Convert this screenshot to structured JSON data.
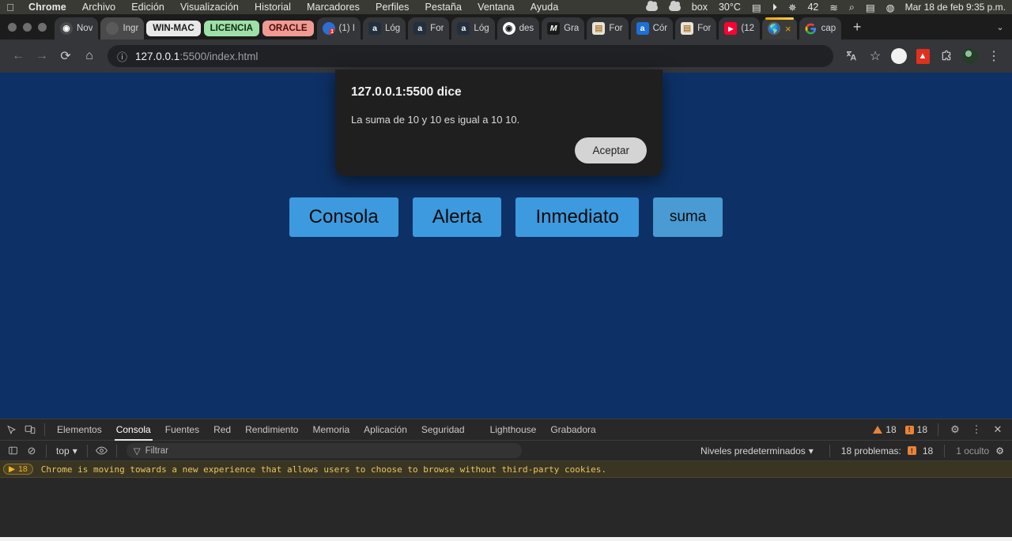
{
  "macbar": {
    "apple_icon": "apple-icon",
    "menus": [
      {
        "label": "Chrome",
        "bold": true
      },
      {
        "label": "Archivo",
        "bold": false
      },
      {
        "label": "Edición",
        "bold": false
      },
      {
        "label": "Visualización",
        "bold": false
      },
      {
        "label": "Historial",
        "bold": false
      },
      {
        "label": "Marcadores",
        "bold": false
      },
      {
        "label": "Perfiles",
        "bold": false
      },
      {
        "label": "Pestaña",
        "bold": false
      },
      {
        "label": "Ventana",
        "bold": false
      },
      {
        "label": "Ayuda",
        "bold": false
      }
    ],
    "status_items": [
      {
        "name": "cloud-icon-1",
        "text": ""
      },
      {
        "name": "cloud-icon-2",
        "text": ""
      },
      {
        "name": "box-logo",
        "text": "box"
      },
      {
        "name": "calendar-icon",
        "text": "30°C"
      },
      {
        "name": "numbers-icon",
        "text": ""
      },
      {
        "name": "play-icon",
        "text": "▶"
      },
      {
        "name": "bluetooth-icon",
        "text": "✦"
      },
      {
        "name": "battery-icon",
        "text": "42"
      },
      {
        "name": "wifi-icon",
        "text": "≋"
      },
      {
        "name": "spotlight-search-icon",
        "text": "⌕"
      },
      {
        "name": "control-center-icon",
        "text": "▤"
      },
      {
        "name": "siri-icon",
        "text": ""
      }
    ],
    "clock": "Mar 18 de feb 9:35 p.m."
  },
  "tabstrip": {
    "window_controls": [
      "close",
      "minimize",
      "maximize"
    ],
    "tabs": [
      {
        "kind": "tab",
        "favicon": "chrome-ic",
        "glyph": "◉",
        "label": "Nov",
        "group": false
      },
      {
        "kind": "tab",
        "favicon": "pill",
        "glyph": "",
        "label": "Ingr",
        "group": true
      },
      {
        "kind": "group",
        "label": "WIN-MAC",
        "bg": "#e8e8e8",
        "fg": "#1a1a1a"
      },
      {
        "kind": "group",
        "label": "LICENCIA",
        "bg": "#9ee0a8",
        "fg": "#0f2a14"
      },
      {
        "kind": "group",
        "label": "ORACLE",
        "bg": "#f09a95",
        "fg": "#4a0d0a"
      },
      {
        "kind": "tab",
        "favicon": "chrome-notif",
        "glyph": "1",
        "label": "(1) I",
        "group": false
      },
      {
        "kind": "tab",
        "favicon": "amazon",
        "glyph": "a",
        "label": "Lóg",
        "group": false
      },
      {
        "kind": "tab",
        "favicon": "amazon",
        "glyph": "a",
        "label": "For",
        "group": false
      },
      {
        "kind": "tab",
        "favicon": "amazon",
        "glyph": "a",
        "label": "Lóg",
        "group": false
      },
      {
        "kind": "tab",
        "favicon": "gh",
        "glyph": "⬤",
        "label": "des",
        "group": false
      },
      {
        "kind": "tab",
        "favicon": "m",
        "glyph": "M",
        "label": "Gra",
        "group": false
      },
      {
        "kind": "tab",
        "favicon": "doc",
        "glyph": "▤",
        "label": "For",
        "group": false
      },
      {
        "kind": "tab",
        "favicon": "a-blue",
        "glyph": "a",
        "label": "Cór",
        "group": false
      },
      {
        "kind": "tab",
        "favicon": "doc",
        "glyph": "▤",
        "label": "For",
        "group": false
      },
      {
        "kind": "tab",
        "favicon": "yt",
        "glyph": "▶",
        "label": "(12",
        "group": false
      },
      {
        "kind": "tab-active",
        "favicon": "globe",
        "glyph": "⊕",
        "label": "",
        "close": "×"
      },
      {
        "kind": "tab",
        "favicon": "gchrome",
        "glyph": "G",
        "label": "cap",
        "group": false
      }
    ],
    "new_tab_label": "+",
    "tab_list_chevron": "⌄"
  },
  "toolbar": {
    "back_icon": "←",
    "forward_icon": "→",
    "reload_icon": "⟳",
    "home_icon": "⌂",
    "site_info_icon": "ⓘ",
    "url_host": "127.0.0.1",
    "url_path": ":5500/index.html",
    "translate_icon": "文",
    "bookmark_icon": "☆",
    "pdf_icon": "A",
    "extensions_icon": "⧉",
    "menu_icon": "⋮"
  },
  "dialog": {
    "title": "127.0.0.1:5500 dice",
    "message": "La suma de 10  y 10 es igual a 10 10.",
    "accept_label": "Aceptar"
  },
  "page": {
    "background_color": "#0d3166",
    "button_color": "#3d9ade",
    "buttons": [
      {
        "label": "Consola",
        "size": "big"
      },
      {
        "label": "Alerta",
        "size": "big"
      },
      {
        "label": "Inmediato",
        "size": "big"
      },
      {
        "label": "suma",
        "size": "small"
      }
    ]
  },
  "devtools": {
    "inspect_icon": "⌖",
    "device_icon": "▭",
    "tabs": [
      {
        "label": "Elementos",
        "active": false
      },
      {
        "label": "Consola",
        "active": true
      },
      {
        "label": "Fuentes",
        "active": false
      },
      {
        "label": "Red",
        "active": false
      },
      {
        "label": "Rendimiento",
        "active": false
      },
      {
        "label": "Memoria",
        "active": false
      },
      {
        "label": "Aplicación",
        "active": false
      },
      {
        "label": "Seguridad",
        "active": false
      },
      {
        "label": "Lighthouse",
        "active": false
      },
      {
        "label": "Grabadora",
        "active": false
      }
    ],
    "warning_count": "18",
    "error_count": "18",
    "settings_icon": "⚙",
    "more_icon": "⋮",
    "close_icon": "✕",
    "filterbar": {
      "clear_icon": "⊘",
      "context": "top",
      "context_chevron": "▾",
      "eye_icon": "◉",
      "filter_icon": "▽",
      "filter_placeholder": "Filtrar",
      "levels_label": "Niveles predeterminados",
      "levels_chevron": "▾",
      "problems_label": "18 problemas:",
      "problems_count": "18",
      "hidden_label": "1 oculto",
      "console_settings_icon": "⚙"
    },
    "message": {
      "expand_icon": "▶",
      "count": "18",
      "text": "Chrome is moving towards a new experience that allows users to choose to browse without third-party cookies."
    }
  }
}
